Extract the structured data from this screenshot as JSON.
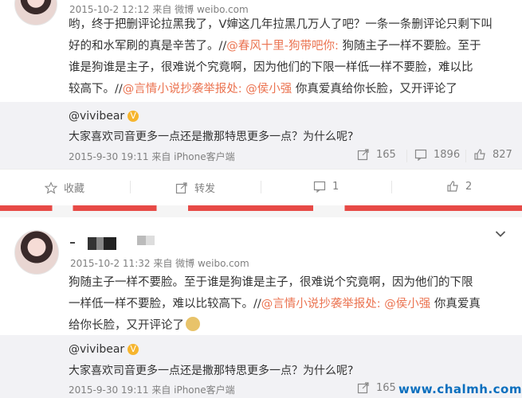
{
  "post1": {
    "meta": "2015-10-2 12:12 来自 微博 weibo.com",
    "body_lines": [
      "哟，终于把删评论拉黑我了，V婶这几年拉黑几万人了吧？一条一条删评论只剩下叫",
      "好的和水军刷的真是辛苦了。//",
      "谁是狗谁是主子，很难说个究竟啊，因为他们的下限一样低一样不要脸，难以比",
      "较高下。//"
    ],
    "mention1": "@春风十里-狗带吧你:",
    "after_mention1": " 狗随主子一样不要脸。至于",
    "mention2": "@言情小说抄袭举报处:",
    "mention3": "@侯小强",
    "after_mention3": " 你真爱真给你长脸，又开评论了",
    "repost": {
      "user": "@vivibear",
      "vip": "V",
      "text": "大家喜欢司音更多一点还是撒那特思更多一点？为什么呢?",
      "meta": "2015-9-30 19:11 来自 iPhone客户端",
      "forwards": "165",
      "comments": "1896",
      "likes": "827"
    },
    "actions": {
      "favorite": "收藏",
      "forward": "转发",
      "comment": "1",
      "like": "2"
    }
  },
  "post2": {
    "meta": "2015-10-2 11:32 来自 微博 weibo.com",
    "body_line1": "狗随主子一样不要脸。至于谁是狗谁是主子，很难说个究竟啊，因为他们的下限",
    "body_line2_start": "一样低一样不要脸，难以比较高下。//",
    "mention2": "@言情小说抄袭举报处:",
    "mention3": "@侯小强",
    "after_mention3": " 你真爱真",
    "body_line3": "给你长脸，又开评论了",
    "repost": {
      "user": "@vivibear",
      "vip": "V",
      "text": "大家喜欢司音更多一点还是撒那特思更多一点？为什么呢?",
      "meta": "2015-9-30 19:11 来自 iPhone客户端",
      "forwards": "165"
    }
  },
  "watermark": "www.chalmh.com",
  "colors": {
    "link": "#eb7350",
    "watermark": "#0b6fbe"
  }
}
